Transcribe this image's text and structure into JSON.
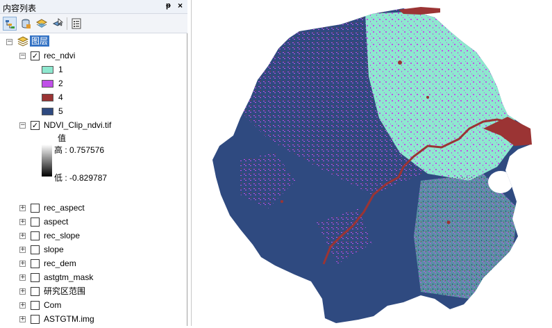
{
  "panel": {
    "title": "内容列表",
    "pin": "ᵽ",
    "close": "×"
  },
  "toolbar": {
    "icons": [
      "list-by-drawing-order-icon",
      "list-by-source-icon",
      "list-by-visibility-icon",
      "list-by-selection-icon",
      "options-icon"
    ]
  },
  "tree": {
    "root_label": "图层",
    "layers": [
      {
        "name": "rec_ndvi",
        "checked": true,
        "expanded": true,
        "classes": [
          {
            "label": "1",
            "color": "#8ee8cf"
          },
          {
            "label": "2",
            "color": "#c050e8"
          },
          {
            "label": "4",
            "color": "#9b3434"
          },
          {
            "label": "5",
            "color": "#2f4a80"
          }
        ]
      },
      {
        "name": "NDVI_Clip_ndvi.tif",
        "checked": true,
        "expanded": true,
        "legend_title": "值",
        "high": "高 : 0.757576",
        "low": "低 : -0.829787"
      },
      {
        "name": "rec_aspect",
        "checked": false,
        "expanded": false
      },
      {
        "name": "aspect",
        "checked": false,
        "expanded": false
      },
      {
        "name": "rec_slope",
        "checked": false,
        "expanded": false
      },
      {
        "name": "slope",
        "checked": false,
        "expanded": false
      },
      {
        "name": "rec_dem",
        "checked": false,
        "expanded": false
      },
      {
        "name": "astgtm_mask",
        "checked": false,
        "expanded": false
      },
      {
        "name": "研究区范围",
        "checked": false,
        "expanded": false
      },
      {
        "name": "Com",
        "checked": false,
        "expanded": false
      },
      {
        "name": "ASTGTM.img",
        "checked": false,
        "expanded": false
      }
    ]
  },
  "symbols": {
    "collapse": "−",
    "expand": "+",
    "check": "✓"
  },
  "map": {
    "colors": {
      "class1": "#8ee8cf",
      "class2": "#c050e8",
      "class4": "#9b3434",
      "class5": "#2f4a80"
    }
  }
}
